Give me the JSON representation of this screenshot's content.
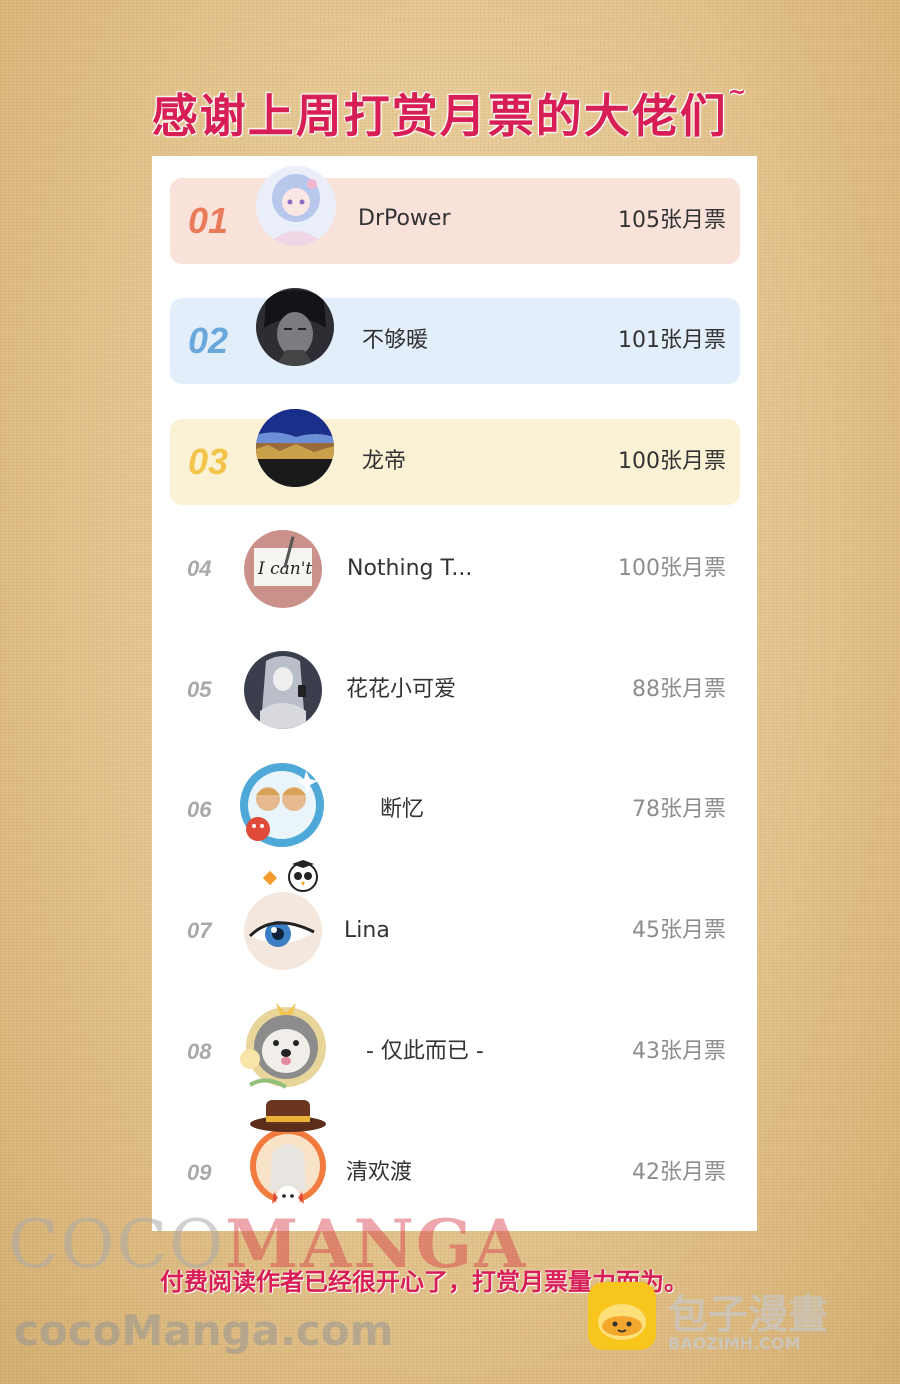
{
  "title": "感谢上周打赏月票的大佬们",
  "title_tilde": "~",
  "rows": [
    {
      "rank": "01",
      "name": "DrPower",
      "votes": "105张月票",
      "bg": "#f9e2da",
      "rank_color": "#e97a5a",
      "avatar": "anime-girl-avatar"
    },
    {
      "rank": "02",
      "name": "不够暖",
      "votes": "101张月票",
      "bg": "#e2eefa",
      "rank_color": "#6aa8dc",
      "avatar": "dark-anime-avatar"
    },
    {
      "rank": "03",
      "name": "龙帝",
      "votes": "100张月票",
      "bg": "#fbf2d6",
      "rank_color": "#f2c54a",
      "avatar": "landscape-avatar"
    },
    {
      "rank": "04",
      "name": "Nothing T...",
      "votes": "100张月票",
      "avatar": "i-cant-avatar"
    },
    {
      "rank": "05",
      "name": "花花小可爱",
      "votes": "88张月票",
      "avatar": "sitting-girl-avatar"
    },
    {
      "rank": "06",
      "name": "断忆",
      "votes": "78张月票",
      "avatar": "twins-avatar"
    },
    {
      "rank": "07",
      "name": "Lina",
      "votes": "45张月票",
      "avatar": "eye-avatar"
    },
    {
      "rank": "08",
      "name": "- 仅此而已 -",
      "votes": "43张月票",
      "avatar": "dog-avatar"
    },
    {
      "rank": "09",
      "name": "清欢渡",
      "votes": "42张月票",
      "avatar": "hat-character-avatar"
    }
  ],
  "watermark_coco": "COCO",
  "watermark_manga": "MANGA",
  "footer": "付费阅读作者已经很开心了，打赏月票量力而为。",
  "site": "cocoManga.com",
  "brand_text": "包子漫畫",
  "brand_sub": "BAOZIMH.COM"
}
